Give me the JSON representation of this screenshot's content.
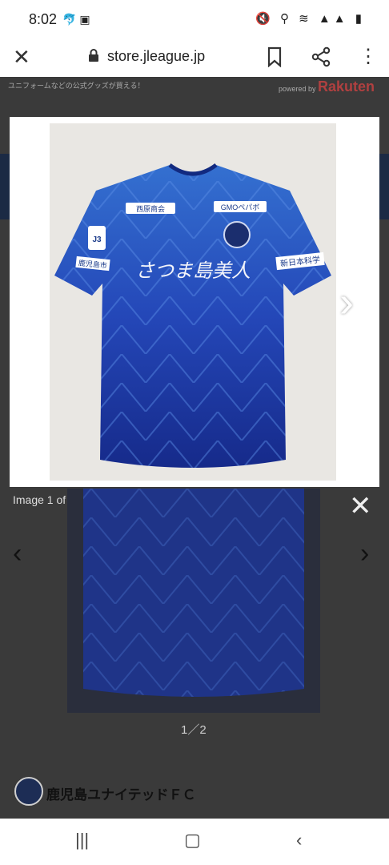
{
  "status_bar": {
    "time": "8:02",
    "notif_icons": "🐬 ▣",
    "right_icons": "🔇 ⚲ ≋ ▲▲ ▮"
  },
  "url_bar": {
    "url": "store.jleague.jp"
  },
  "site": {
    "promo_text": "ユニフォームなどの公式グッズが買える！",
    "powered_by": "powered by",
    "rakuten": "Rakuten"
  },
  "lightbox": {
    "image_alt": "Blue Kagoshima United FC jersey",
    "caption": "Image 1 of 2",
    "sponsor_left": "西原商会",
    "sponsor_right": "GMOペパボ",
    "chest_text": "さつま島美人",
    "sleeve_right": "新日本科学",
    "sleeve_left": "鹿児島市",
    "league_badge": "J3"
  },
  "page": {
    "pager": "1／2",
    "club_name": "鹿児島ユナイテッドＦＣ"
  },
  "colors": {
    "jersey_blue": "#1e3aa8",
    "jersey_light": "#3c7ad8",
    "modal_bg": "#ffffff",
    "overlay": "#3a3a3a"
  }
}
